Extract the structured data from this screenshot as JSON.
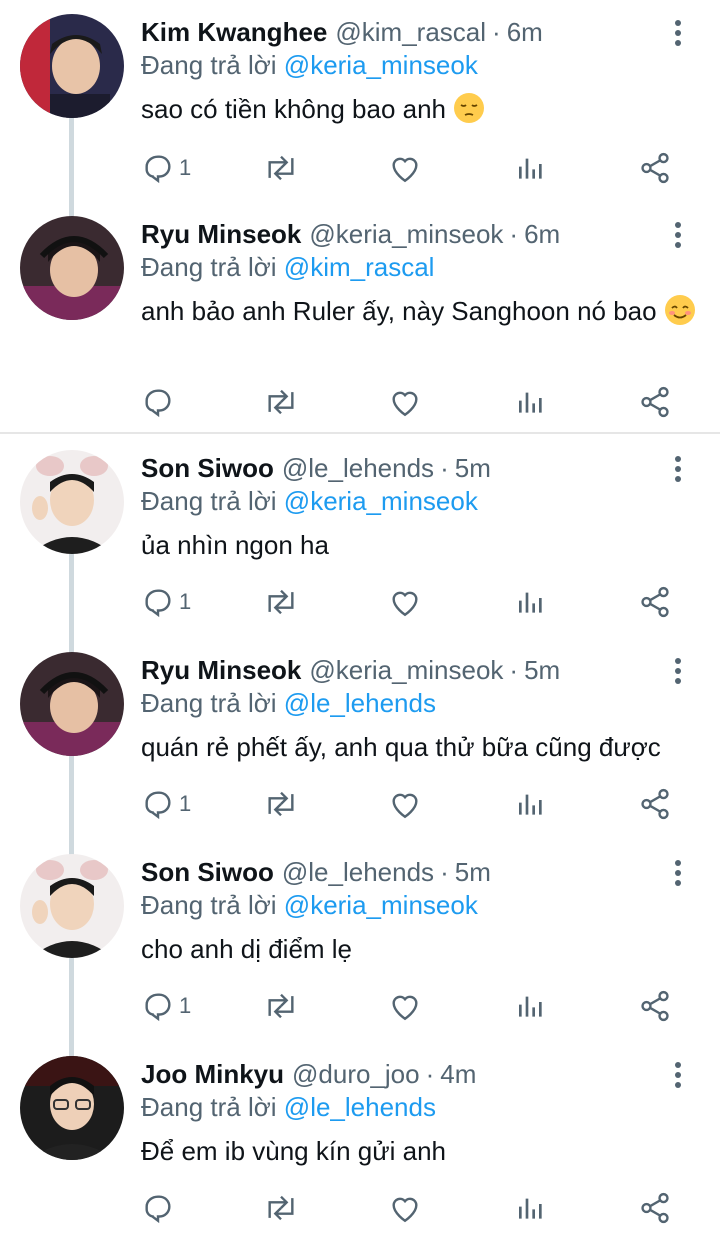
{
  "reply_prefix": "Đang trả lời",
  "separator": "·",
  "tweets": [
    {
      "name": "Kim Kwanghee",
      "handle": "@kim_rascal",
      "time": "6m",
      "reply_to": "@keria_minseok",
      "text": "sao có tiền không bao anh",
      "reply_count": "1"
    },
    {
      "name": "Ryu Minseok",
      "handle": "@keria_minseok",
      "time": "6m",
      "reply_to": "@kim_rascal",
      "text": "anh bảo anh Ruler ấy, này Sanghoon nó bao",
      "reply_count": ""
    },
    {
      "name": "Son Siwoo",
      "handle": "@le_lehends",
      "time": "5m",
      "reply_to": "@keria_minseok",
      "text": "ủa nhìn ngon ha",
      "reply_count": "1"
    },
    {
      "name": "Ryu Minseok",
      "handle": "@keria_minseok",
      "time": "5m",
      "reply_to": "@le_lehends",
      "text": "quán rẻ phết ấy, anh qua thử bữa cũng được",
      "reply_count": "1"
    },
    {
      "name": "Son Siwoo",
      "handle": "@le_lehends",
      "time": "5m",
      "reply_to": "@keria_minseok",
      "text": "cho anh dị điểm lẹ",
      "reply_count": "1"
    },
    {
      "name": "Joo Minkyu",
      "handle": "@duro_joo",
      "time": "4m",
      "reply_to": "@le_lehends",
      "text": "Để em ib vùng kín gửi anh",
      "reply_count": ""
    }
  ],
  "colors": {
    "mention": "#1d9bf0",
    "secondary": "#536471",
    "thread_line": "#cfd9de"
  },
  "icons": [
    "more-icon",
    "reply-icon",
    "retweet-icon",
    "like-icon",
    "views-icon",
    "share-icon",
    "pensive-emoji",
    "smiling-blush-emoji"
  ]
}
